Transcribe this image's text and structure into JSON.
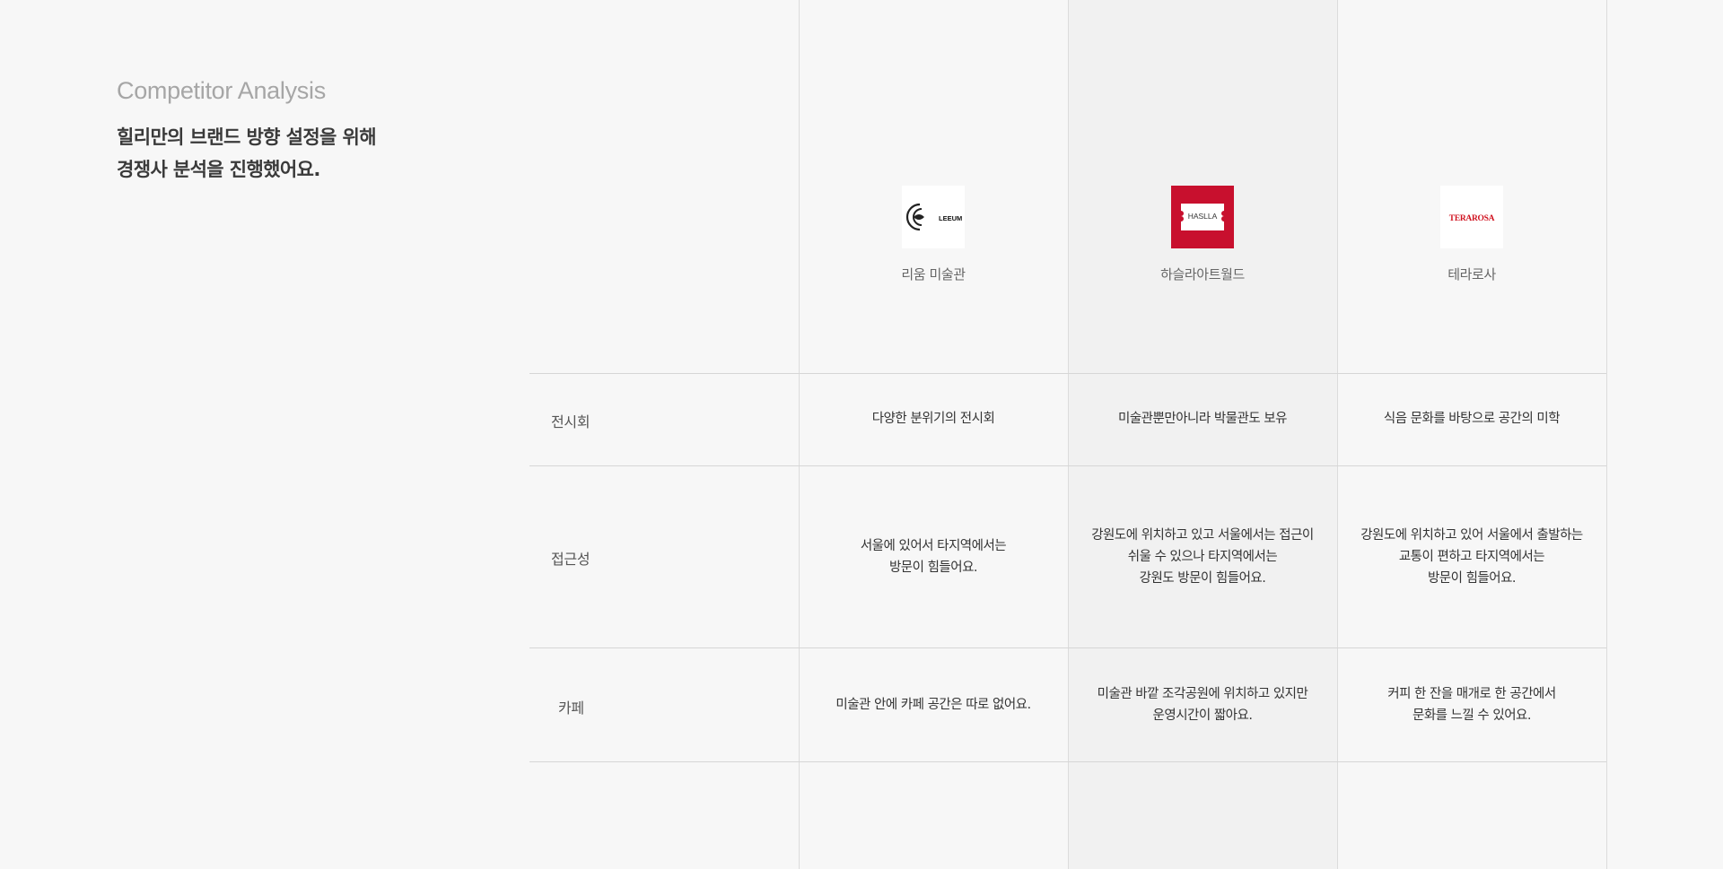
{
  "intro": {
    "eyebrow": "Competitor Analysis",
    "heading_line1": "힐리만의 브랜드 방향 설정을 위해",
    "heading_line2": "경쟁사 분석을 진행했어요."
  },
  "competitors": [
    {
      "name": "리움 미술관",
      "logo_text": "LEEUM",
      "logo_icon": "leeum-swirl-logo"
    },
    {
      "name": "하슬라아트월드",
      "logo_text": "HASLLA",
      "logo_icon": "haslla-ticket-logo",
      "logo_bg": "#c8102e"
    },
    {
      "name": "테라로사",
      "logo_text": "TERAROSA",
      "logo_icon": "terarosa-wordmark",
      "logo_color": "#d0121f"
    }
  ],
  "rows": {
    "exhibition": {
      "label": "전시회",
      "cells": [
        [
          "다양한 분위기의 전시회"
        ],
        [
          "미술관뿐만아니라 박물관도 보유"
        ],
        [
          "식음 문화를 바탕으로 공간의 미학"
        ]
      ]
    },
    "access": {
      "label": "접근성",
      "cells": [
        [
          "서울에 있어서 타지역에서는",
          "방문이 힘들어요."
        ],
        [
          "강원도에 위치하고 있고 서울에서는 접근이",
          "쉬울 수 있으나 타지역에서는",
          "강원도 방문이 힘들어요."
        ],
        [
          "강원도에 위치하고 있어 서울에서 출발하는",
          "교통이 편하고 타지역에서는",
          "방문이 힘들어요."
        ]
      ]
    },
    "cafe": {
      "label": "카페",
      "cells": [
        [
          "미술관 안에 카페 공간은 따로 없어요."
        ],
        [
          "미술관 바깥 조각공원에 위치하고 있지만",
          "운영시간이 짧아요."
        ],
        [
          "커피 한 잔을 매개로 한 공간에서",
          "문화를 느낄 수 있어요."
        ]
      ]
    }
  }
}
